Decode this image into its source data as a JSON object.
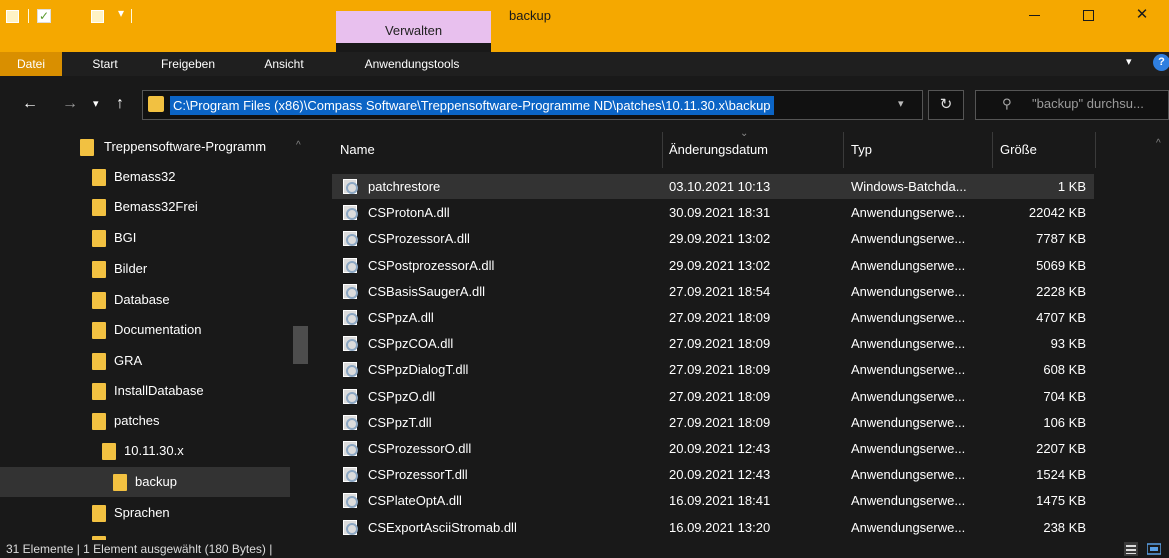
{
  "window": {
    "title": "backup",
    "context_tab": "Verwalten",
    "buttons": {
      "minimize": "minimize",
      "maximize": "maximize",
      "close": "✕"
    }
  },
  "ribbon": {
    "tabs": [
      "Datei",
      "Start",
      "Freigeben",
      "Ansicht",
      "Anwendungstools"
    ],
    "help": "?"
  },
  "address": {
    "path": "C:\\Program Files (x86)\\Compass Software\\Treppensoftware-Programme ND\\patches\\10.11.30.x\\backup",
    "search_placeholder": "\"backup\" durchsu..."
  },
  "nav_tree": [
    {
      "label": "Treppensoftware-Programm",
      "level": 0
    },
    {
      "label": "Bemass32",
      "level": 1
    },
    {
      "label": "Bemass32Frei",
      "level": 1
    },
    {
      "label": "BGI",
      "level": 1
    },
    {
      "label": "Bilder",
      "level": 1
    },
    {
      "label": "Database",
      "level": 1
    },
    {
      "label": "Documentation",
      "level": 1
    },
    {
      "label": "GRA",
      "level": 1
    },
    {
      "label": "InstallDatabase",
      "level": 1
    },
    {
      "label": "patches",
      "level": 1
    },
    {
      "label": "10.11.30.x",
      "level": 2
    },
    {
      "label": "backup",
      "level": 3,
      "selected": true
    },
    {
      "label": "Sprachen",
      "level": 1
    }
  ],
  "columns": {
    "name": "Name",
    "date": "Änderungsdatum",
    "type": "Typ",
    "size": "Größe"
  },
  "files": [
    {
      "name": "patchrestore",
      "date": "03.10.2021 10:13",
      "type": "Windows-Batchda...",
      "size": "1 KB",
      "selected": true
    },
    {
      "name": "CSProtonA.dll",
      "date": "30.09.2021 18:31",
      "type": "Anwendungserwe...",
      "size": "22042 KB"
    },
    {
      "name": "CSProzessorA.dll",
      "date": "29.09.2021 13:02",
      "type": "Anwendungserwe...",
      "size": "7787 KB"
    },
    {
      "name": "CSPostprozessorA.dll",
      "date": "29.09.2021 13:02",
      "type": "Anwendungserwe...",
      "size": "5069 KB"
    },
    {
      "name": "CSBasisSaugerA.dll",
      "date": "27.09.2021 18:54",
      "type": "Anwendungserwe...",
      "size": "2228 KB"
    },
    {
      "name": "CSPpzA.dll",
      "date": "27.09.2021 18:09",
      "type": "Anwendungserwe...",
      "size": "4707 KB"
    },
    {
      "name": "CSPpzCOA.dll",
      "date": "27.09.2021 18:09",
      "type": "Anwendungserwe...",
      "size": "93 KB"
    },
    {
      "name": "CSPpzDialogT.dll",
      "date": "27.09.2021 18:09",
      "type": "Anwendungserwe...",
      "size": "608 KB"
    },
    {
      "name": "CSPpzO.dll",
      "date": "27.09.2021 18:09",
      "type": "Anwendungserwe...",
      "size": "704 KB"
    },
    {
      "name": "CSPpzT.dll",
      "date": "27.09.2021 18:09",
      "type": "Anwendungserwe...",
      "size": "106 KB"
    },
    {
      "name": "CSProzessorO.dll",
      "date": "20.09.2021 12:43",
      "type": "Anwendungserwe...",
      "size": "2207 KB"
    },
    {
      "name": "CSProzessorT.dll",
      "date": "20.09.2021 12:43",
      "type": "Anwendungserwe...",
      "size": "1524 KB"
    },
    {
      "name": "CSPlateOptA.dll",
      "date": "16.09.2021 18:41",
      "type": "Anwendungserwe...",
      "size": "1475 KB"
    },
    {
      "name": "CSExportAsciiStromab.dll",
      "date": "16.09.2021 13:20",
      "type": "Anwendungserwe...",
      "size": "238 KB"
    }
  ],
  "status": {
    "text": "31 Elemente  |  1 Element ausgewählt (180 Bytes)  |"
  },
  "colors": {
    "accent": "#f5a800",
    "context_tab": "#e8c0ee",
    "selection": "#0b64c5",
    "folder": "#f2c141"
  }
}
